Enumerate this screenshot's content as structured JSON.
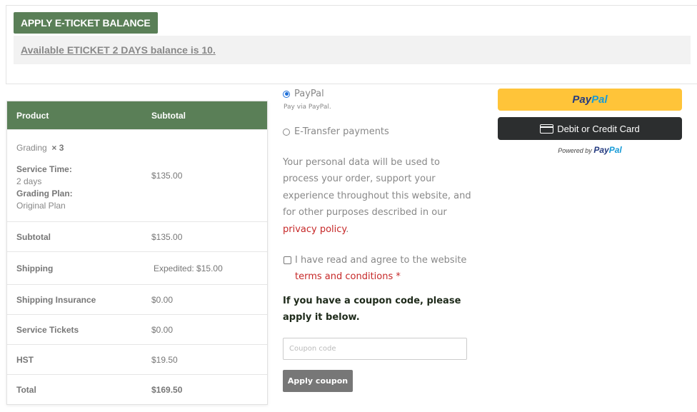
{
  "eticket": {
    "apply_button": "APPLY E-TICKET BALANCE",
    "balance_text": "Available ETICKET 2 DAYS balance is 10."
  },
  "order": {
    "headers": {
      "product": "Product",
      "subtotal": "Subtotal"
    },
    "item": {
      "name": "Grading",
      "qty": "× 3",
      "service_time_label": "Service Time:",
      "service_time_value": "2 days",
      "plan_label": "Grading Plan:",
      "plan_value": "Original Plan",
      "price": "$135.00"
    },
    "rows": {
      "subtotal_label": "Subtotal",
      "subtotal_value": "$135.00",
      "shipping_label": "Shipping",
      "shipping_value": "Expedited: $15.00",
      "insurance_label": "Shipping Insurance",
      "insurance_value": "$0.00",
      "tickets_label": "Service Tickets",
      "tickets_value": "$0.00",
      "hst_label": "HST",
      "hst_value": "$19.50",
      "total_label": "Total",
      "total_value": "$169.50"
    }
  },
  "payment": {
    "paypal_label": "PayPal",
    "paypal_desc": "Pay via PayPal.",
    "etransfer_label": "E-Transfer payments",
    "privacy_text": "Your personal data will be used to process your order, support your experience throughout this website, and for other purposes described in our ",
    "privacy_link": "privacy policy",
    "privacy_end": ".",
    "terms_text": "I have read and agree to the website",
    "terms_link": "terms and conditions",
    "terms_required": "*",
    "coupon_note": "If you have a coupon code, please apply it below.",
    "coupon_placeholder": "Coupon code",
    "coupon_button": "Apply coupon"
  },
  "paypal_buttons": {
    "brand_pay": "Pay",
    "brand_pal": "Pal",
    "card_label": "Debit or Credit Card",
    "powered_by": "Powered by"
  },
  "colors": {
    "accent_green": "#5a7f57",
    "paypal_yellow": "#ffc439",
    "link_red": "#c62828"
  }
}
